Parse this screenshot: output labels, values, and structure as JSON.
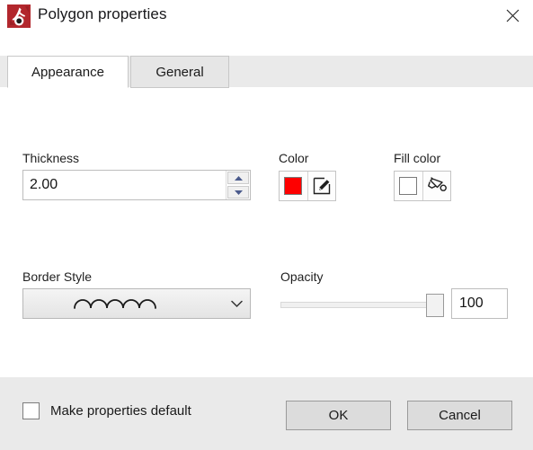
{
  "window": {
    "title": "Polygon properties",
    "app_icon": "polygon-properties-icon",
    "close_icon": "close-icon",
    "brand_color": "#b2272d"
  },
  "tabs": [
    {
      "label": "Appearance",
      "selected": true
    },
    {
      "label": "General",
      "selected": false
    }
  ],
  "appearance": {
    "thickness": {
      "label": "Thickness",
      "value": "2.00",
      "spin_up_icon": "spin-up-icon",
      "spin_down_icon": "spin-down-icon"
    },
    "color": {
      "label": "Color",
      "swatch_color": "#fe0000",
      "edit_icon": "pencil-edit-icon"
    },
    "fill_color": {
      "label": "Fill color",
      "swatch_color": "#ffffff",
      "bucket_icon": "paint-bucket-icon"
    },
    "border_style": {
      "label": "Border Style",
      "selected_style": "scalloped-arc-line",
      "arrow_icon": "chevron-down-icon"
    },
    "opacity": {
      "label": "Opacity",
      "value": "100",
      "min": 0,
      "max": 100
    }
  },
  "footer": {
    "make_default": {
      "label": "Make properties default",
      "checked": false
    },
    "ok_label": "OK",
    "cancel_label": "Cancel"
  }
}
